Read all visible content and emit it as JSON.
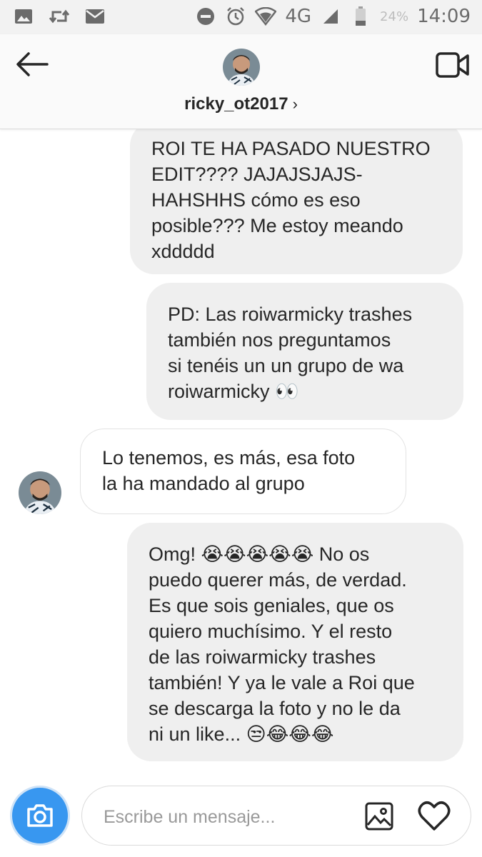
{
  "status_bar": {
    "network": "4G",
    "battery": "24%",
    "time": "14:09"
  },
  "header": {
    "username": "ricky_ot2017",
    "chevron": "›"
  },
  "messages": [
    {
      "sender": "me",
      "text": "ROI TE HA PASADO NUESTRO\nEDIT???? JAJAJSJAJS-\nHAHSHHS cómo es eso\nposible??? Me estoy meando\nxddddd"
    },
    {
      "sender": "me",
      "text": "PD: Las roiwarmicky trashes\ntambién nos preguntamos\nsi tenéis un un grupo de wa\nroiwarmicky 👀"
    },
    {
      "sender": "ricky_ot2017",
      "text": "Lo tenemos, es más, esa foto\nla ha mandado al grupo"
    },
    {
      "sender": "me",
      "text": "Omg! 😭😭😭😭😭 No os\npuedo querer más, de verdad.\nEs que sois geniales, que os\nquiero muchísimo. Y el resto\nde las roiwarmicky trashes\ntambién! Y ya le vale a Roi que\nse descarga la foto y no le da\nni un like... 😒😂😂😂"
    }
  ],
  "composer": {
    "placeholder": "Escribe un mensaje..."
  },
  "icons": {
    "back": "back-arrow-icon",
    "video": "video-camera-icon",
    "camera": "camera-icon",
    "gallery": "gallery-icon",
    "heart": "heart-icon"
  },
  "colors": {
    "accent": "#3897f0",
    "outgoing_bubble": "#efefef",
    "incoming_border": "#e2e2e2"
  }
}
